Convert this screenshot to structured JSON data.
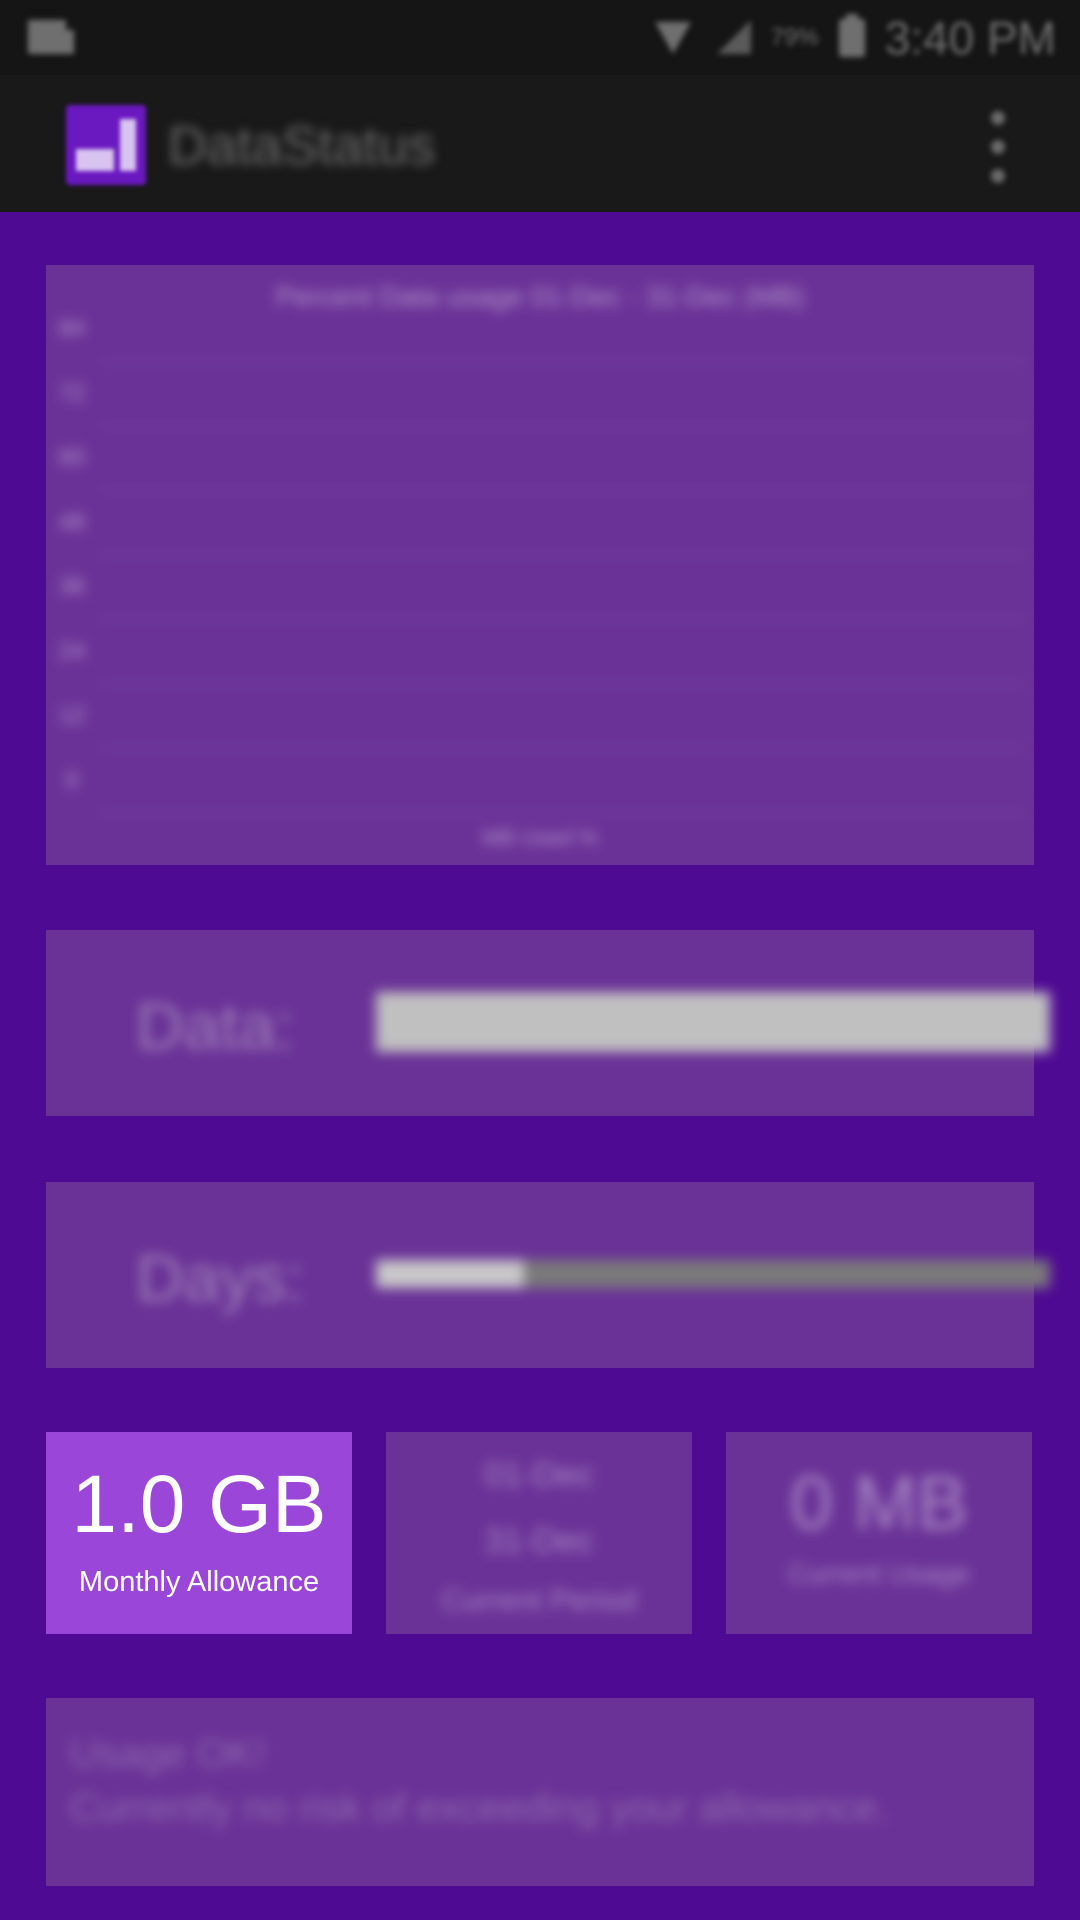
{
  "status_bar": {
    "battery_percent": "79%",
    "time": "3:40 PM"
  },
  "app_bar": {
    "title": "DataStatus"
  },
  "chart_data": {
    "type": "line",
    "title": "Percent Data usage 01-Dec - 31-Dec (MB)",
    "xlabel": "MB Used %",
    "ylabel": "",
    "y_ticks": [
      "84",
      "72",
      "60",
      "48",
      "36",
      "24",
      "12",
      "0"
    ],
    "ylim": [
      0,
      84
    ],
    "series": []
  },
  "data_bar": {
    "label": "Data:",
    "fill_fraction": 1.0,
    "fill_color": "#c0c0c0",
    "track_color": "#8a7a8e"
  },
  "days_bar": {
    "label": "Days:",
    "fill_fraction": 0.22,
    "fill_color": "#c8c8c8",
    "track_color": "#7a7a7a"
  },
  "tiles": {
    "allowance": {
      "value": "1.0 GB",
      "label": "Monthly Allowance",
      "color": "#9a46d9"
    },
    "period": {
      "start": "01-Dec",
      "end": "31-Dec",
      "label": "Current Period"
    },
    "usage": {
      "value": "0 MB",
      "label": "Current Usage"
    }
  },
  "status": {
    "title": "Usage OK!",
    "message": "Currently no risk of exceeding your allowance."
  },
  "colors": {
    "background": "#4f0a93",
    "card": "#6a3297",
    "appbar": "#191919"
  }
}
